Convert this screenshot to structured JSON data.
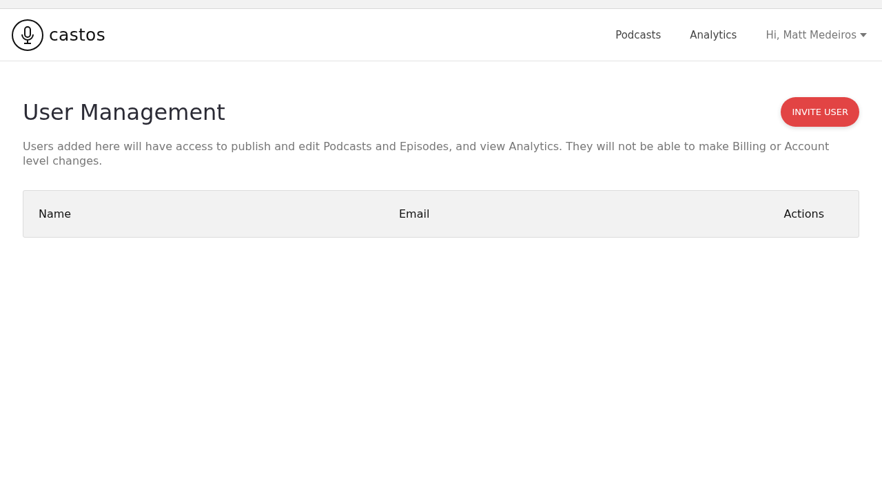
{
  "header": {
    "logo": "castos",
    "nav": [
      {
        "label": "Podcasts"
      },
      {
        "label": "Analytics"
      }
    ],
    "user_menu": "Hi, Matt Medeiros"
  },
  "page": {
    "title": "User Management",
    "invite_button": "INVITE USER",
    "description": "Users added here will have access to publish and edit Podcasts and Episodes, and view Analytics. They will not be able to make Billing or Account level changes."
  },
  "table": {
    "columns": [
      "Name",
      "Email",
      "Actions"
    ]
  }
}
